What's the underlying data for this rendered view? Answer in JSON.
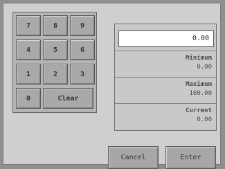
{
  "keypad": {
    "keys": [
      "7",
      "8",
      "9",
      "4",
      "5",
      "6",
      "1",
      "2",
      "3",
      "0"
    ],
    "clear_label": "Clear"
  },
  "entry": {
    "value": "0.00"
  },
  "limits": {
    "minimum_label": "Minimum",
    "minimum_value": "0.00",
    "maximum_label": "Maximum",
    "maximum_value": "160.00",
    "current_label": "Current",
    "current_value": "0.00"
  },
  "actions": {
    "cancel_label": "Cancel",
    "enter_label": "Enter"
  }
}
